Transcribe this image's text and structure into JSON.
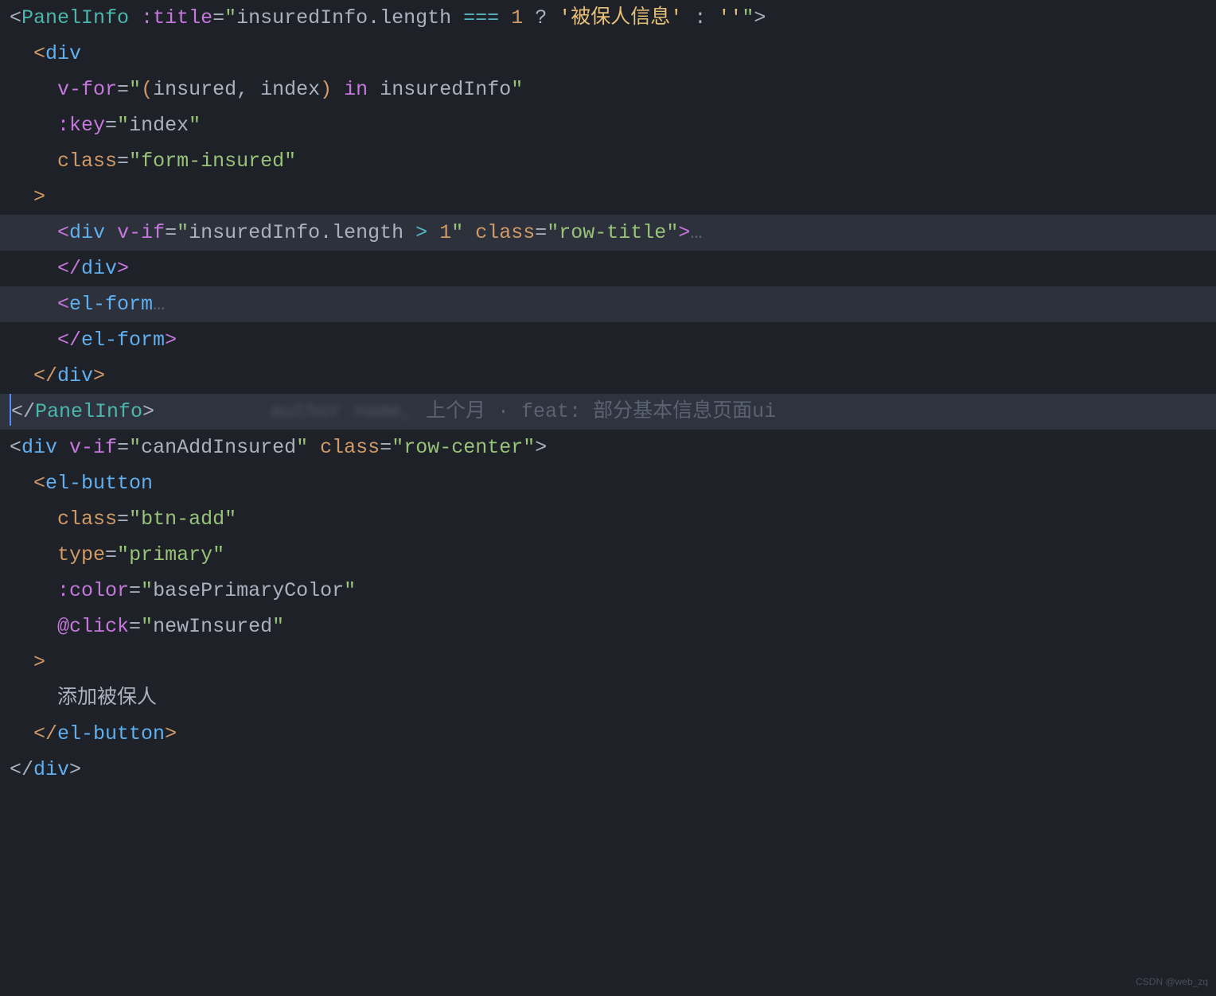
{
  "code": {
    "l1": {
      "open": "<",
      "comp": "PanelInfo",
      "sp": " ",
      "attr": ":title",
      "eq": "=",
      "q1": "\"",
      "expr1": "insuredInfo.length ",
      "opEq": "===",
      "sp2": " ",
      "num": "1",
      "sp3": " ",
      "tern": "?",
      "sp4": " ",
      "sq1": "'",
      "zh": "被保人信息",
      "sq2": "'",
      "sp5": " ",
      "colon": ":",
      "sp6": " ",
      "empty": "''",
      "q2": "\"",
      "close": ">"
    },
    "l2": {
      "open": "<",
      "tag": "div"
    },
    "l3": {
      "attr": "v-for",
      "eq": "=",
      "q1": "\"",
      "p1": "(",
      "a1": "insured",
      "c": ",",
      "sp": " ",
      "a2": "index",
      "p2": ")",
      "in": " in ",
      "a3": "insuredInfo",
      "q2": "\""
    },
    "l4": {
      "attr": ":key",
      "eq": "=",
      "q1": "\"",
      "val": "index",
      "q2": "\""
    },
    "l5": {
      "attr": "class",
      "eq": "=",
      "q1": "\"",
      "val": "form-insured",
      "q2": "\""
    },
    "l6": {
      "close": ">"
    },
    "l7": {
      "open": "<",
      "tag": "div",
      "sp": " ",
      "attr1": "v-if",
      "eq1": "=",
      "q1": "\"",
      "expr": "insuredInfo.length ",
      "op": ">",
      "sp2": " ",
      "num": "1",
      "q2": "\"",
      "sp3": " ",
      "attr2": "class",
      "eq2": "=",
      "q3": "\"",
      "val": "row-title",
      "q4": "\"",
      "close": ">",
      "fold": "…"
    },
    "l8": {
      "open": "</",
      "tag": "div",
      "close": ">"
    },
    "l9": {
      "open": "<",
      "tag": "el-form",
      "fold": "…"
    },
    "l10": {
      "open": "</",
      "tag": "el-form",
      "close": ">"
    },
    "l11": {
      "open": "</",
      "tag": "div",
      "close": ">"
    },
    "l12": {
      "open": "</",
      "comp": "PanelInfo",
      "close": ">"
    },
    "blame": "上个月 · feat: 部分基本信息页面ui",
    "l13": {
      "open": "<",
      "tag": "div",
      "sp": " ",
      "attr1": "v-if",
      "eq1": "=",
      "q1": "\"",
      "val1": "canAddInsured",
      "q2": "\"",
      "sp2": " ",
      "attr2": "class",
      "eq2": "=",
      "q3": "\"",
      "val2": "row-center",
      "q4": "\"",
      "close": ">"
    },
    "l14": {
      "open": "<",
      "tag": "el-button"
    },
    "l15": {
      "attr": "class",
      "eq": "=",
      "q1": "\"",
      "val": "btn-add",
      "q2": "\""
    },
    "l16": {
      "attr": "type",
      "eq": "=",
      "q1": "\"",
      "val": "primary",
      "q2": "\""
    },
    "l17": {
      "attr": ":color",
      "eq": "=",
      "q1": "\"",
      "val": "basePrimaryColor",
      "q2": "\""
    },
    "l18": {
      "attr": "@click",
      "eq": "=",
      "q1": "\"",
      "val": "newInsured",
      "q2": "\""
    },
    "l19": {
      "close": ">"
    },
    "l20": {
      "text": "添加被保人"
    },
    "l21": {
      "open": "</",
      "tag": "el-button",
      "close": ">"
    },
    "l22": {
      "open": "</",
      "tag": "div",
      "close": ">"
    }
  },
  "watermark": "CSDN @web_zq"
}
